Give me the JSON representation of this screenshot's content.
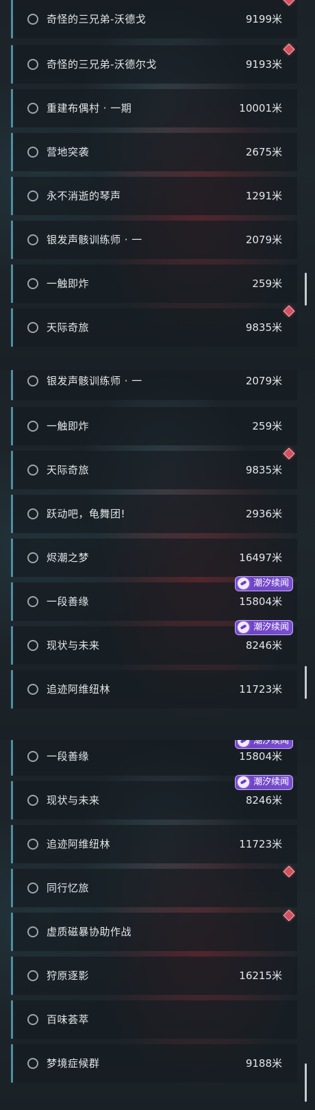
{
  "panels": [
    {
      "rows": [
        {
          "name": "奇怪的三兄弟-沃德戈",
          "distance": "9199米",
          "marker": "gem"
        },
        {
          "name": "奇怪的三兄弟-沃德尔戈",
          "distance": "9193米",
          "marker": "gem"
        },
        {
          "name": "重建布偶村 · 一期",
          "distance": "10001米",
          "marker": ""
        },
        {
          "name": "营地突袭",
          "distance": "2675米",
          "marker": ""
        },
        {
          "name": "永不消逝的琴声",
          "distance": "1291米",
          "marker": ""
        },
        {
          "name": "银发声骸训练师 · 一",
          "distance": "2079米",
          "marker": ""
        },
        {
          "name": "一触即炸",
          "distance": "259米",
          "marker": ""
        },
        {
          "name": "天际奇旅",
          "distance": "9835米",
          "marker": "gem"
        }
      ]
    },
    {
      "rows": [
        {
          "name": "银发声骸训练师 · 一",
          "distance": "2079米",
          "marker": ""
        },
        {
          "name": "一触即炸",
          "distance": "259米",
          "marker": ""
        },
        {
          "name": "天际奇旅",
          "distance": "9835米",
          "marker": "gem"
        },
        {
          "name": "跃动吧，龟舞团!",
          "distance": "2936米",
          "marker": ""
        },
        {
          "name": "烬潮之梦",
          "distance": "16497米",
          "marker": ""
        },
        {
          "name": "一段善缘",
          "distance": "15804米",
          "marker": "tag"
        },
        {
          "name": "现状与未来",
          "distance": "8246米",
          "marker": "tag"
        },
        {
          "name": "追迹阿维纽林",
          "distance": "11723米",
          "marker": ""
        }
      ]
    },
    {
      "rows": [
        {
          "name": "一段善缘",
          "distance": "15804米",
          "marker": "tag"
        },
        {
          "name": "现状与未来",
          "distance": "8246米",
          "marker": "tag"
        },
        {
          "name": "追迹阿维纽林",
          "distance": "11723米",
          "marker": ""
        },
        {
          "name": "同行忆旅",
          "distance": "",
          "marker": "gem"
        },
        {
          "name": "虚质磁暴协助作战",
          "distance": "",
          "marker": "gem"
        },
        {
          "name": "狩原逐影",
          "distance": "16215米",
          "marker": ""
        },
        {
          "name": "百味荟萃",
          "distance": "",
          "marker": ""
        },
        {
          "name": "梦境症候群",
          "distance": "9188米",
          "marker": ""
        }
      ]
    }
  ],
  "tag_label": "潮汐续闻",
  "colors": {
    "accent_bar": "#4e8fa3",
    "gem": "#d2515e",
    "tag": "#6a3fc0"
  }
}
